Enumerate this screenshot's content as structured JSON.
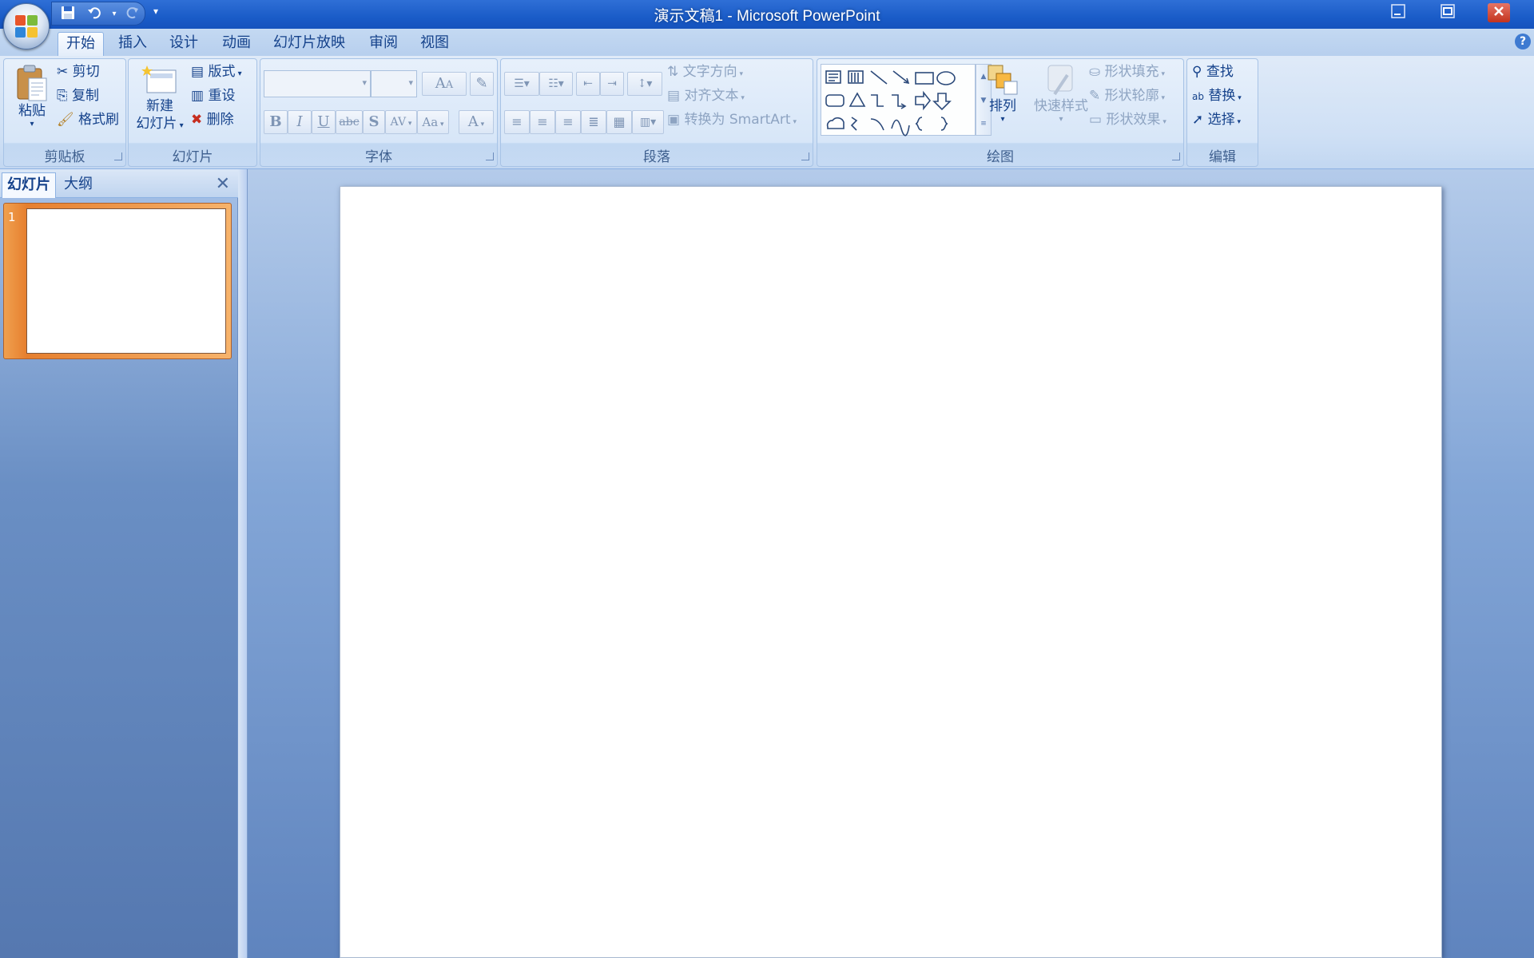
{
  "window": {
    "title": "演示文稿1 - Microsoft PowerPoint",
    "minimize_icon": "minimize-icon",
    "maximize_icon": "maximize-icon",
    "close_icon": "close-icon"
  },
  "quick_access": {
    "save_icon": "save-icon",
    "undo_icon": "undo-icon",
    "redo_icon": "redo-icon",
    "customize_icon": "chevron-down-icon"
  },
  "tabs": [
    "开始",
    "插入",
    "设计",
    "动画",
    "幻灯片放映",
    "审阅",
    "视图"
  ],
  "active_tab": "开始",
  "ribbon": {
    "clipboard": {
      "label": "剪贴板",
      "paste": "粘贴",
      "cut": "剪切",
      "copy": "复制",
      "format_painter": "格式刷"
    },
    "slides": {
      "label": "幻灯片",
      "new_slide_line1": "新建",
      "new_slide_line2": "幻灯片",
      "layout": "版式",
      "reset": "重设",
      "delete": "删除"
    },
    "font": {
      "label": "字体",
      "font_name": "",
      "font_size": "",
      "bold": "B",
      "italic": "I",
      "underline": "U",
      "strike": "abc",
      "shadow": "S",
      "spacing": "AV",
      "case": "Aa",
      "grow": "A",
      "shrink": "A",
      "color": "A"
    },
    "paragraph": {
      "label": "段落",
      "text_direction": "文字方向",
      "align_text": "对齐文本",
      "smartart": "转换为 SmartArt"
    },
    "drawing": {
      "label": "绘图",
      "arrange": "排列",
      "quick_styles": "快速样式",
      "shape_fill": "形状填充",
      "shape_outline": "形状轮廓",
      "shape_effects": "形状效果"
    },
    "editing": {
      "label": "编辑",
      "find": "查找",
      "replace": "替换",
      "select": "选择"
    }
  },
  "left_pane": {
    "tab_slides": "幻灯片",
    "tab_outline": "大纲",
    "close_icon": "close-icon",
    "slide_number": "1"
  },
  "colors": {
    "title_bar": "#1a5cc8",
    "ribbon": "#cfe0f5",
    "workspace": "#83a6d7",
    "thumbnail_selected": "#e67f2e"
  }
}
